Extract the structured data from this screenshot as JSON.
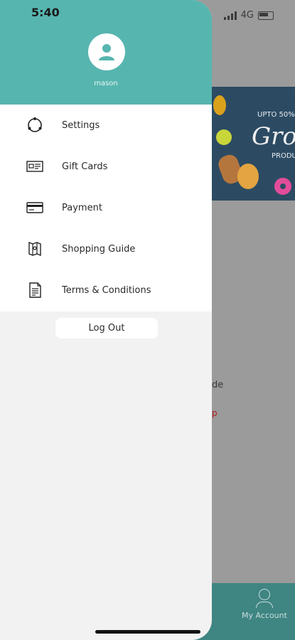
{
  "status_bar": {
    "time": "5:40",
    "network": "4G"
  },
  "drawer": {
    "user_name": "mason",
    "menu_items": [
      {
        "label": "Settings",
        "icon": "settings-icon"
      },
      {
        "label": "Gift Cards",
        "icon": "gift-card-icon"
      },
      {
        "label": "Payment",
        "icon": "credit-card-icon"
      },
      {
        "label": "Shopping Guide",
        "icon": "map-icon"
      },
      {
        "label": "Terms & Conditions",
        "icon": "document-icon"
      }
    ],
    "logout_label": "Log Out"
  },
  "background": {
    "banner_upto": "UPTO 50%",
    "banner_title": "Groc",
    "banner_sub": "PRODU",
    "partial_text1": "de",
    "partial_text2": "p",
    "bottom_tab_account": "My Account"
  },
  "colors": {
    "accent": "#57b5af",
    "drawer_bg": "#f2f2f2",
    "overlay": "#9b9b9b"
  }
}
